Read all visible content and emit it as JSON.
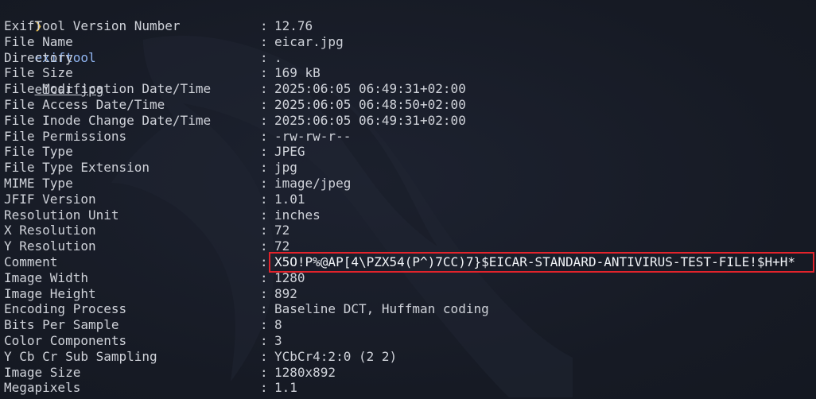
{
  "prompt": {
    "arrow": "❯",
    "command": "exiftool",
    "argument": "eicar.jpg"
  },
  "rows": [
    {
      "key": "ExifTool Version Number",
      "value": "12.76"
    },
    {
      "key": "File Name",
      "value": "eicar.jpg"
    },
    {
      "key": "Directory",
      "value": "."
    },
    {
      "key": "File Size",
      "value": "169 kB"
    },
    {
      "key": "File Modification Date/Time",
      "value": "2025:06:05 06:49:31+02:00"
    },
    {
      "key": "File Access Date/Time",
      "value": "2025:06:05 06:48:50+02:00"
    },
    {
      "key": "File Inode Change Date/Time",
      "value": "2025:06:05 06:49:31+02:00"
    },
    {
      "key": "File Permissions",
      "value": "-rw-rw-r--"
    },
    {
      "key": "File Type",
      "value": "JPEG"
    },
    {
      "key": "File Type Extension",
      "value": "jpg"
    },
    {
      "key": "MIME Type",
      "value": "image/jpeg"
    },
    {
      "key": "JFIF Version",
      "value": "1.01"
    },
    {
      "key": "Resolution Unit",
      "value": "inches"
    },
    {
      "key": "X Resolution",
      "value": "72"
    },
    {
      "key": "Y Resolution",
      "value": "72"
    },
    {
      "key": "Comment",
      "value": "X5O!P%@AP[4\\PZX54(P^)7CC)7}$EICAR-STANDARD-ANTIVIRUS-TEST-FILE!$H+H*"
    },
    {
      "key": "Image Width",
      "value": "1280"
    },
    {
      "key": "Image Height",
      "value": "892"
    },
    {
      "key": "Encoding Process",
      "value": "Baseline DCT, Huffman coding"
    },
    {
      "key": "Bits Per Sample",
      "value": "8"
    },
    {
      "key": "Color Components",
      "value": "3"
    },
    {
      "key": "Y Cb Cr Sub Sampling",
      "value": "YCbCr4:2:0 (2 2)"
    },
    {
      "key": "Image Size",
      "value": "1280x892"
    },
    {
      "key": "Megapixels",
      "value": "1.1"
    }
  ],
  "separator": ":",
  "colors": {
    "background": "#171b26",
    "text": "#cfd2d9",
    "prompt_arrow": "#e0b64a",
    "command": "#8fb4f0",
    "highlight_border": "#e3232b"
  },
  "watermark_icon": "kali-dragon-icon"
}
